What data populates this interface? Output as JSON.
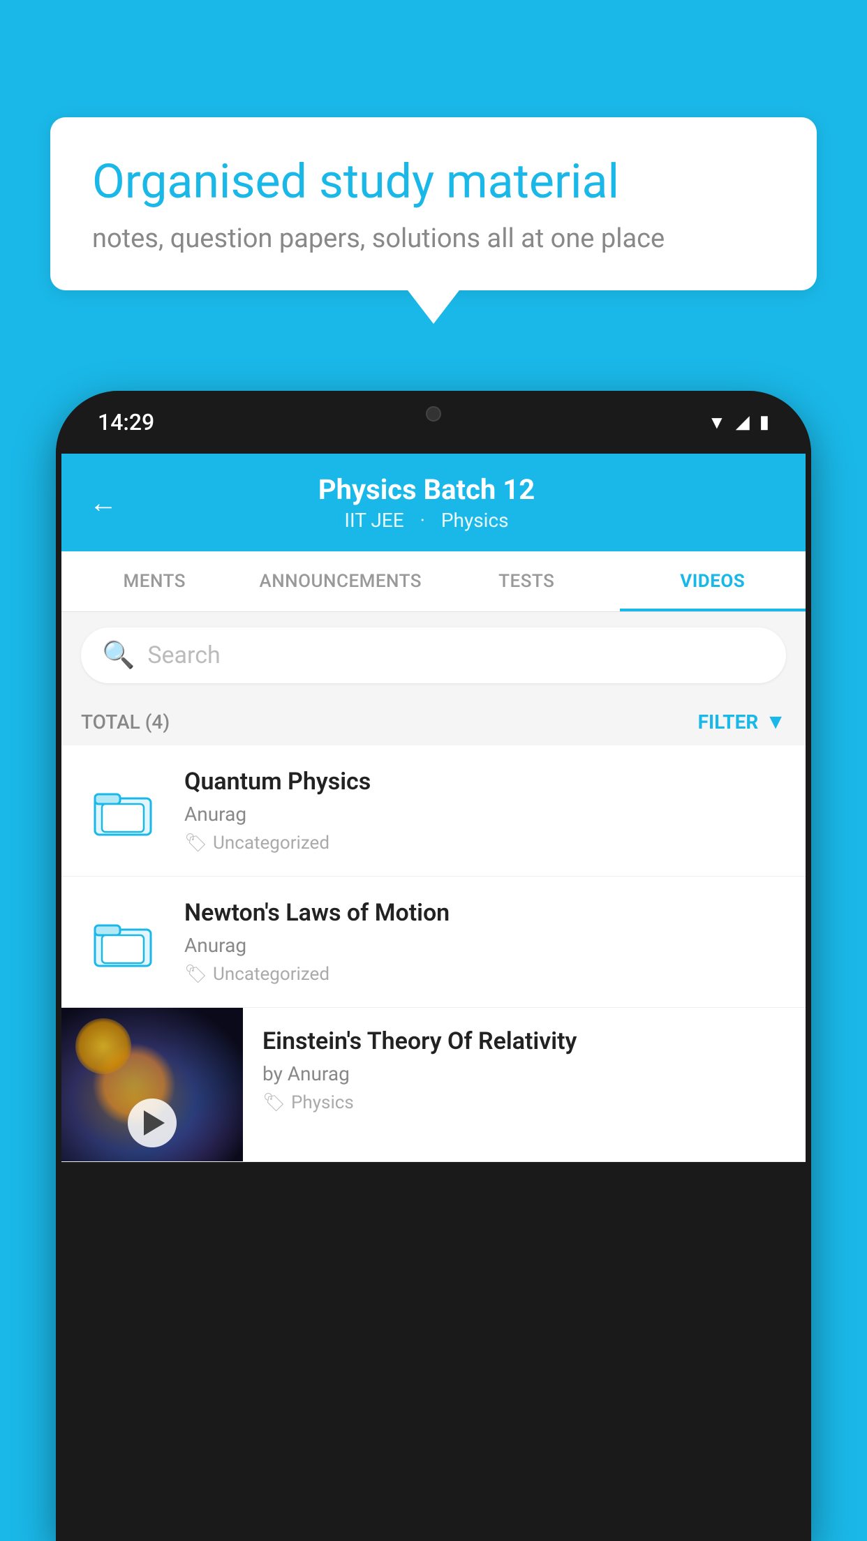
{
  "background": {
    "color": "#1ab8e8"
  },
  "speech_bubble": {
    "title": "Organised study material",
    "subtitle": "notes, question papers, solutions all at one place"
  },
  "phone": {
    "status_bar": {
      "time": "14:29",
      "icons": [
        "wifi",
        "signal",
        "battery"
      ]
    },
    "header": {
      "title": "Physics Batch 12",
      "subtitle_part1": "IIT JEE",
      "subtitle_part2": "Physics",
      "back_label": "←"
    },
    "tabs": [
      {
        "label": "MENTS",
        "active": false
      },
      {
        "label": "ANNOUNCEMENTS",
        "active": false
      },
      {
        "label": "TESTS",
        "active": false
      },
      {
        "label": "VIDEOS",
        "active": true
      }
    ],
    "search": {
      "placeholder": "Search"
    },
    "filter_bar": {
      "total_label": "TOTAL (4)",
      "filter_label": "FILTER"
    },
    "video_items": [
      {
        "title": "Quantum Physics",
        "author": "Anurag",
        "tag": "Uncategorized",
        "type": "folder"
      },
      {
        "title": "Newton's Laws of Motion",
        "author": "Anurag",
        "tag": "Uncategorized",
        "type": "folder"
      },
      {
        "title": "Einstein's Theory Of Relativity",
        "author": "by Anurag",
        "tag": "Physics",
        "type": "thumbnail"
      }
    ]
  }
}
